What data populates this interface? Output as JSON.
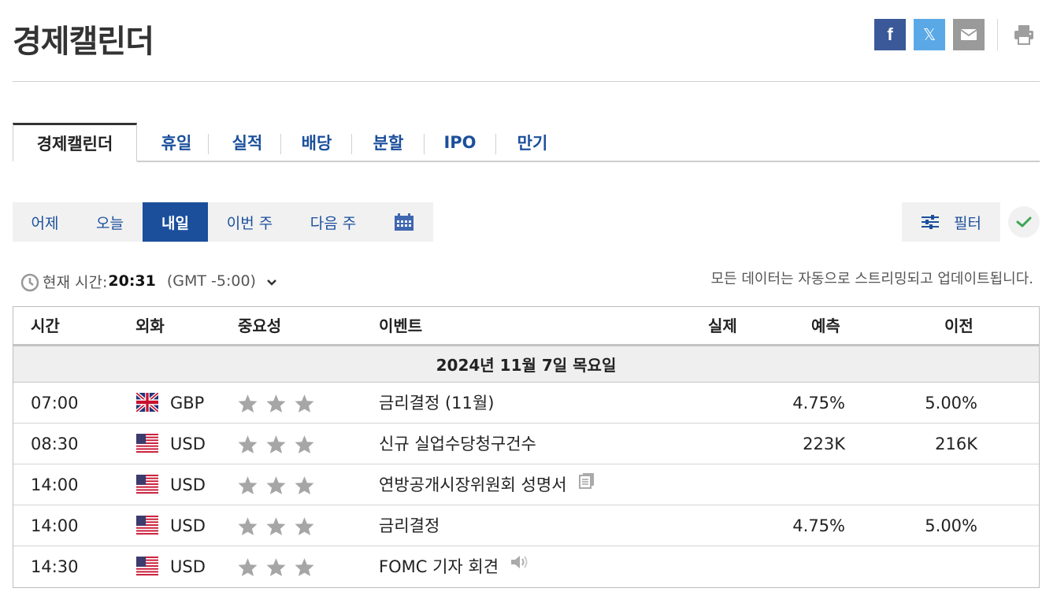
{
  "page": {
    "title": "경제캘린더"
  },
  "share": {
    "facebook_icon": "f",
    "x_icon": "𝕏",
    "mail_icon": "mail-icon",
    "print_icon": "print-icon"
  },
  "main_tabs": [
    {
      "label": "경제캘린더",
      "active": true
    },
    {
      "label": "휴일"
    },
    {
      "label": "실적"
    },
    {
      "label": "배당"
    },
    {
      "label": "분할"
    },
    {
      "label": "IPO"
    },
    {
      "label": "만기"
    }
  ],
  "date_tabs": [
    {
      "label": "어제"
    },
    {
      "label": "오늘"
    },
    {
      "label": "내일",
      "active": true
    },
    {
      "label": "이번 주"
    },
    {
      "label": "다음 주"
    },
    {
      "icon": "calendar-icon"
    }
  ],
  "filter": {
    "label": "필터",
    "icon": "sliders-icon"
  },
  "clock": {
    "label": "현재 시간:",
    "time": "20:31",
    "timezone": "(GMT -5:00)"
  },
  "notice": "모든 데이터는 자동으로 스트리밍되고 업데이트됩니다.",
  "table": {
    "headers": {
      "time": "시간",
      "currency": "외화",
      "importance": "중요성",
      "event": "이벤트",
      "actual": "실제",
      "forecast": "예측",
      "previous": "이전"
    },
    "date_label": "2024년 11월 7일 목요일",
    "rows": [
      {
        "time": "07:00",
        "currency": "GBP",
        "flag": "uk",
        "stars": 3,
        "event": "금리결정 (11월)",
        "actual": "",
        "forecast": "4.75%",
        "previous": "5.00%",
        "extra": ""
      },
      {
        "time": "08:30",
        "currency": "USD",
        "flag": "us",
        "stars": 3,
        "event": "신규 실업수당청구건수",
        "actual": "",
        "forecast": "223K",
        "previous": "216K",
        "extra": ""
      },
      {
        "time": "14:00",
        "currency": "USD",
        "flag": "us",
        "stars": 3,
        "event": "연방공개시장위원회 성명서",
        "actual": "",
        "forecast": "",
        "previous": "",
        "extra": "document-icon"
      },
      {
        "time": "14:00",
        "currency": "USD",
        "flag": "us",
        "stars": 3,
        "event": "금리결정",
        "actual": "",
        "forecast": "4.75%",
        "previous": "5.00%",
        "extra": ""
      },
      {
        "time": "14:30",
        "currency": "USD",
        "flag": "us",
        "stars": 3,
        "event": "FOMC 기자 회견",
        "actual": "",
        "forecast": "",
        "previous": "",
        "extra": "speaker-icon"
      }
    ]
  },
  "colors": {
    "link_blue": "#1b4f9c",
    "facebook": "#3b5998",
    "x_blue": "#5aa9e6",
    "mail_gray": "#9a9a9a",
    "star_gray": "#a6a6a6",
    "check_green": "#3aa655"
  }
}
